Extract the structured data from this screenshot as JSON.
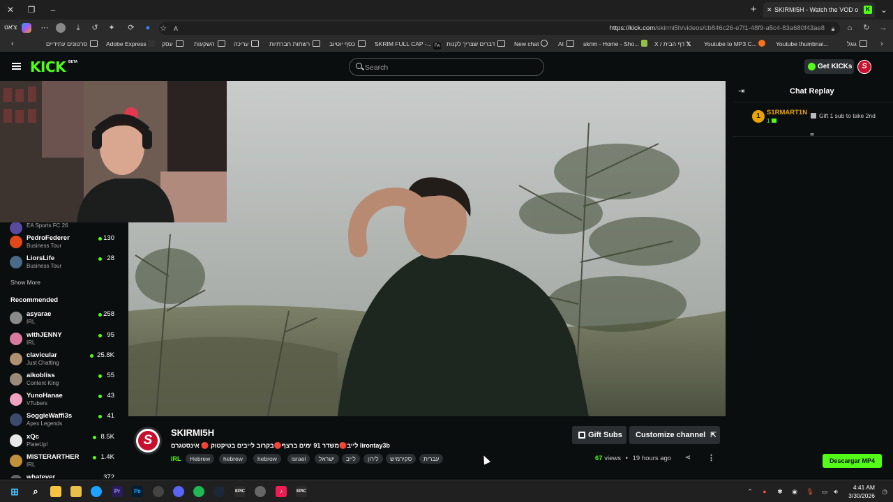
{
  "browser": {
    "active_tab_title": "SKIRMI5H - Watch the VOD o",
    "profile_name": "צ'אט",
    "url_domain": "https://kick.com",
    "url_path": "/skirmi5h/videos/cb846c26-e7f1-48f9-a5c4-83a680f43ae8",
    "bookmarks": [
      {
        "label": "סרטונים עתידיים",
        "icon": "folder-icon"
      },
      {
        "label": "Adobe Express",
        "icon": "adobe-express-icon"
      },
      {
        "label": "עסק",
        "icon": "folder-icon"
      },
      {
        "label": "השקעות",
        "icon": "folder-icon"
      },
      {
        "label": "עריכה",
        "icon": "folder-icon"
      },
      {
        "label": "רשתות חברתיות",
        "icon": "folder-icon"
      },
      {
        "label": "כסף יוטיוב",
        "icon": "folder-icon"
      },
      {
        "label": "SKRIM FULL CAP -...",
        "icon": "fw-icon"
      },
      {
        "label": "דברים שצריך לקנות",
        "icon": "folder-icon"
      },
      {
        "label": "New chat",
        "icon": "chatgpt-icon"
      },
      {
        "label": "AI",
        "icon": "folder-icon"
      },
      {
        "label": "skrim - Home - Sho...",
        "icon": "shopify-icon"
      },
      {
        "label": "X / דף הבית",
        "icon": "x-icon"
      },
      {
        "label": "Youtube to MP3 C...",
        "icon": "converter-icon"
      },
      {
        "label": "Youtube thumbnai...",
        "icon": "blank-page-icon"
      },
      {
        "label": "גוגל",
        "icon": "folder-icon"
      }
    ]
  },
  "header": {
    "logo": "KICK",
    "logo_badge": "BETA",
    "search_placeholder": "Search",
    "get_kicks_label": "Get KICKs",
    "user_avatar_letter": "S"
  },
  "sidebar": {
    "following": [
      {
        "name": "",
        "category": "EA Sports FC 26",
        "viewers": "",
        "avatar_color": "#5a4aa0"
      },
      {
        "name": "PedroFederer",
        "category": "Business Tour",
        "viewers": "130",
        "avatar_color": "#e0481a"
      },
      {
        "name": "LiorsLife",
        "category": "Business Tour",
        "viewers": "28",
        "avatar_color": "#4a6a8a"
      }
    ],
    "show_more": "Show More",
    "recommended_title": "Recommended",
    "recommended": [
      {
        "name": "asyarae",
        "category": "IRL",
        "viewers": "258",
        "avatar_color": "#8a8a8a"
      },
      {
        "name": "withJENNY",
        "category": "IRL",
        "viewers": "95",
        "avatar_color": "#d87aa0"
      },
      {
        "name": "clavicular",
        "category": "Just Chatting",
        "viewers": "25.8K",
        "avatar_color": "#b09070"
      },
      {
        "name": "aikobliss",
        "category": "Content King",
        "viewers": "55",
        "avatar_color": "#9a8a7a"
      },
      {
        "name": "YunoHanae",
        "category": "VTubers",
        "viewers": "43",
        "avatar_color": "#f0a0c0"
      },
      {
        "name": "SoggieWaffl3s",
        "category": "Apex Legends",
        "viewers": "41",
        "avatar_color": "#3a4a6a"
      },
      {
        "name": "xQc",
        "category": "PlateUp!",
        "viewers": "8.5K",
        "avatar_color": "#e8e8e8"
      },
      {
        "name": "MISTERARTHER",
        "category": "IRL",
        "viewers": "1.4K",
        "avatar_color": "#c0903a"
      },
      {
        "name": "whatever",
        "category": "",
        "viewers": "372",
        "avatar_color": "#666666"
      }
    ]
  },
  "video_info": {
    "channel_name": "SKIRMI5H",
    "avatar_letter": "S",
    "title": "לייב🔴משדר 91 ימים ברצף🔴בקרוב לייבים בטיקטוק 🔴 אינסטגרם lirontay3b",
    "category": "IRL",
    "tags": [
      "Hebrew",
      "hebrew",
      "hebrow",
      "israel",
      "ישראל",
      "לייב",
      "לירון",
      "סקירמיש",
      "עברית"
    ],
    "gift_subs_label": "Gift Subs",
    "customize_label": "Customize channel",
    "views_count": "67",
    "views_label": "views",
    "separator": "•",
    "time_ago": "19 hours ago"
  },
  "chat": {
    "title": "Chat Replay",
    "pinned_rank": "1",
    "pinned_user": "S1RMART1N",
    "pinned_sub_count": "1",
    "pinned_message": "Gift 1 sub to take 2nd"
  },
  "extension": {
    "download_label": "Descargar MP4"
  },
  "taskbar": {
    "time": "4:41 AM",
    "date": "3/30/2026"
  },
  "colors": {
    "kick_green": "#53fc18",
    "background": "#0b0e0f",
    "button_gray": "#2b2f31",
    "gold": "#e9a400"
  }
}
